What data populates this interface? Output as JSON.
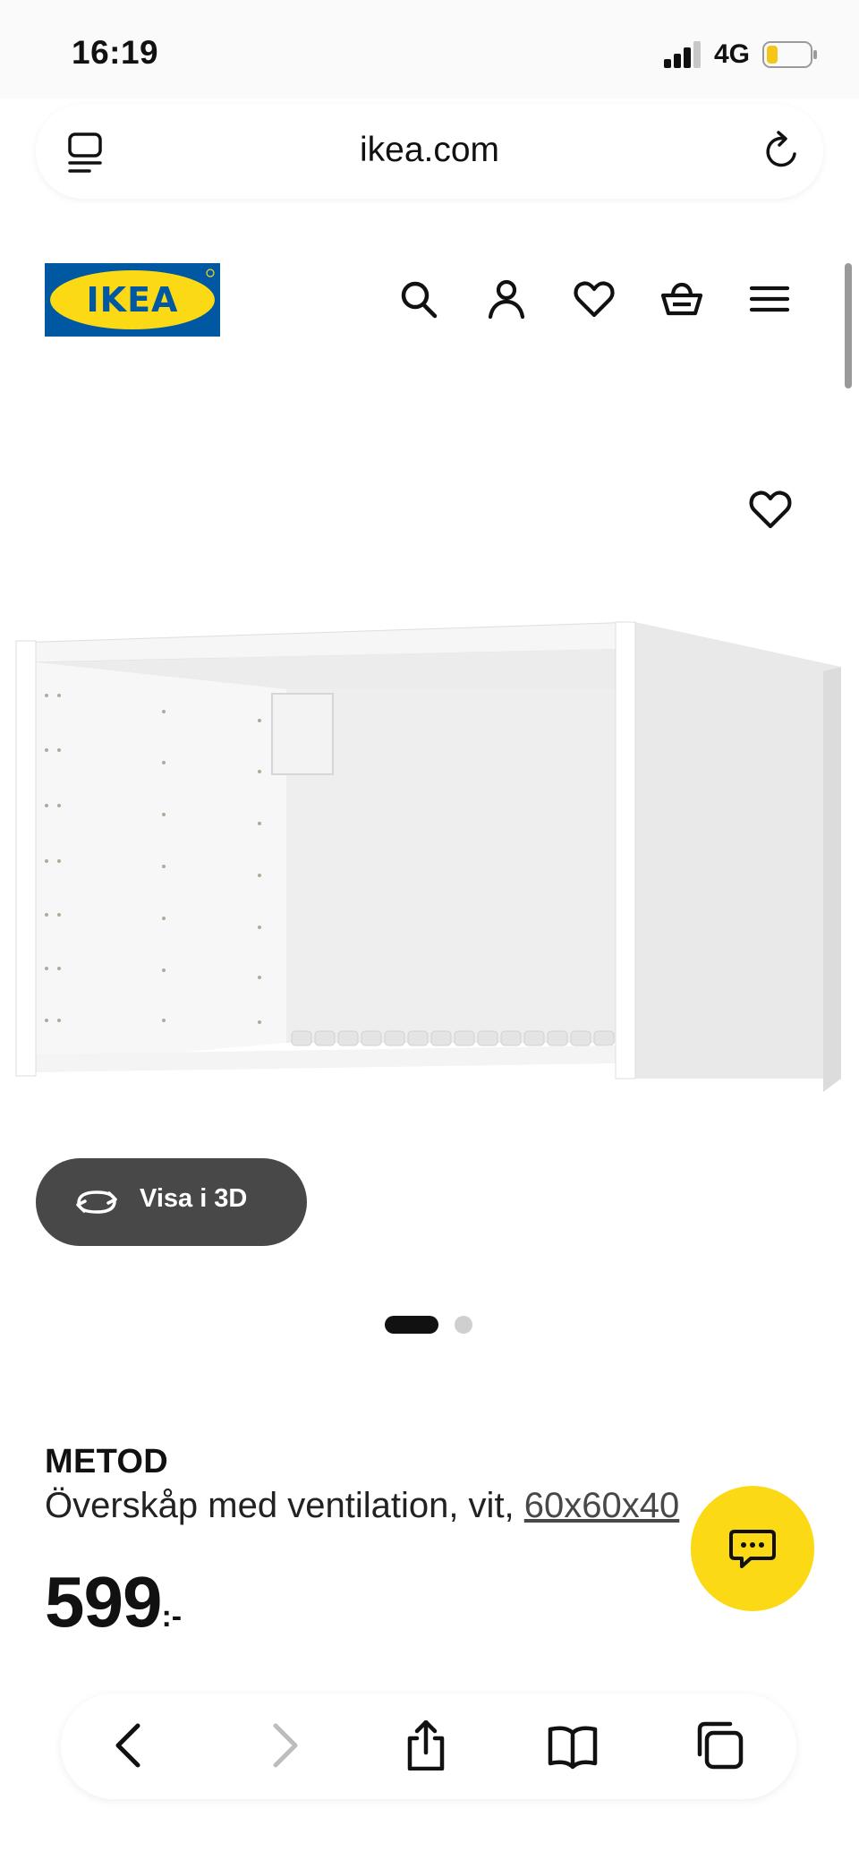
{
  "status_bar": {
    "time": "16:19",
    "network": "4G",
    "icons": [
      "signal-icon",
      "battery-icon"
    ],
    "battery_color": "#f5c518"
  },
  "browser": {
    "url": "ikea.com",
    "icons": [
      "reader-icon",
      "reload-icon"
    ]
  },
  "header": {
    "logo_text": "IKEA",
    "logo_colors": {
      "background": "#0058a3",
      "oval": "#fbd914"
    },
    "nav_icons": [
      "search-icon",
      "account-icon",
      "favorites-icon",
      "basket-icon",
      "menu-icon"
    ]
  },
  "product": {
    "name": "METOD",
    "description": "Överskåp med ventilation, vit, ",
    "size": "60x60x40",
    "price": "599",
    "price_suffix": ":-",
    "view_3d_label": "Visa i 3D",
    "image_count": 2,
    "active_image": 1
  },
  "chat": {
    "icon": "chat-icon",
    "color": "#fbd914"
  },
  "toolbar": {
    "icons": [
      "back-icon",
      "forward-icon",
      "share-icon",
      "bookmarks-icon",
      "tabs-icon"
    ]
  }
}
